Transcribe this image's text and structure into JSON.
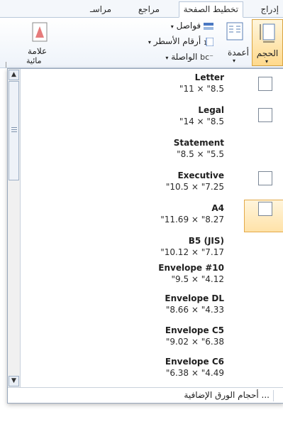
{
  "tabs": [
    "إدراج",
    "تخطيط الصفحة",
    "مراجع",
    "مراسـ"
  ],
  "ribbon": {
    "size_label": "الحجم",
    "columns_label": "أعمدة",
    "breaks_label": "فواصل",
    "line_numbers_label": "أرقام الأسطر",
    "hyphenation_label": "الواصلة",
    "watermark_label_1": "علامة",
    "watermark_label_2": "مائية"
  },
  "paper_sizes": [
    {
      "name": "Letter",
      "dims": "\"11 × \"8.5",
      "has_icon": true
    },
    {
      "name": "Legal",
      "dims": "\"14 × \"8.5",
      "has_icon": true
    },
    {
      "name": "Statement",
      "dims": "\"8.5 × \"5.5",
      "has_icon": false
    },
    {
      "name": "Executive",
      "dims": "\"10.5 × \"7.25",
      "has_icon": true
    },
    {
      "name": "A4",
      "dims": "\"11.69 × \"8.27",
      "has_icon": true,
      "selected": true
    },
    {
      "name": "B5 (JIS)",
      "dims": "\"10.12 × \"7.17",
      "has_icon": false
    },
    {
      "name": "Envelope #10",
      "dims": "\"9.5 × \"4.12",
      "has_icon": false
    },
    {
      "name": "Envelope DL",
      "dims": "\"8.66 × \"4.33",
      "has_icon": false
    },
    {
      "name": "Envelope C5",
      "dims": "\"9.02 × \"6.38",
      "has_icon": false
    },
    {
      "name": "Envelope C6",
      "dims": "\"6.38 × \"4.49",
      "has_icon": false
    }
  ],
  "more_sizes": "أحجام الورق الإضافية ..."
}
